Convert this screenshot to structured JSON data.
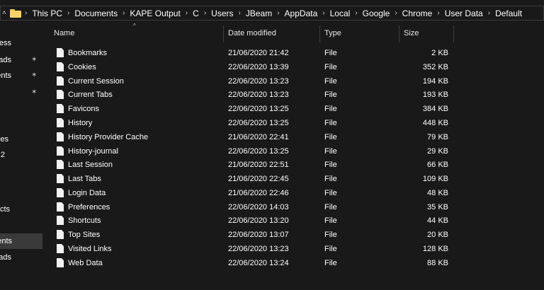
{
  "address_bar": {
    "nav_glyph": "˄",
    "folder_icon": "folder-icon",
    "separator": "›",
    "breadcrumbs": [
      "This PC",
      "Documents",
      "KAPE Output",
      "C",
      "Users",
      "JBeam",
      "AppData",
      "Local",
      "Google",
      "Chrome",
      "User Data",
      "Default"
    ]
  },
  "nav_pane": {
    "items": [
      {
        "label": "ess",
        "pinned": false,
        "selected": false
      },
      {
        "label": "ads",
        "pinned": true,
        "selected": false
      },
      {
        "label": "ents",
        "pinned": true,
        "selected": false
      },
      {
        "label": "",
        "pinned": true,
        "selected": false
      },
      {
        "label": "es",
        "pinned": false,
        "selected": false
      },
      {
        "label": "2",
        "pinned": false,
        "selected": false
      },
      {
        "label": "cts",
        "pinned": false,
        "selected": false
      },
      {
        "label": "ents",
        "pinned": false,
        "selected": true
      },
      {
        "label": "ads",
        "pinned": false,
        "selected": false
      }
    ],
    "pin_glyph": "📌"
  },
  "columns": {
    "name": "Name",
    "date_modified": "Date modified",
    "type": "Type",
    "size": "Size",
    "sort_glyph": "^"
  },
  "files": [
    {
      "name": "Bookmarks",
      "date": "21/06/2020 21:42",
      "type": "File",
      "size": "2 KB"
    },
    {
      "name": "Cookies",
      "date": "22/06/2020 13:39",
      "type": "File",
      "size": "352 KB"
    },
    {
      "name": "Current Session",
      "date": "22/06/2020 13:23",
      "type": "File",
      "size": "194 KB"
    },
    {
      "name": "Current Tabs",
      "date": "22/06/2020 13:23",
      "type": "File",
      "size": "193 KB"
    },
    {
      "name": "Favicons",
      "date": "22/06/2020 13:25",
      "type": "File",
      "size": "384 KB"
    },
    {
      "name": "History",
      "date": "22/06/2020 13:25",
      "type": "File",
      "size": "448 KB"
    },
    {
      "name": "History Provider Cache",
      "date": "21/06/2020 22:41",
      "type": "File",
      "size": "79 KB"
    },
    {
      "name": "History-journal",
      "date": "22/06/2020 13:25",
      "type": "File",
      "size": "29 KB"
    },
    {
      "name": "Last Session",
      "date": "21/06/2020 22:51",
      "type": "File",
      "size": "66 KB"
    },
    {
      "name": "Last Tabs",
      "date": "21/06/2020 22:45",
      "type": "File",
      "size": "109 KB"
    },
    {
      "name": "Login Data",
      "date": "21/06/2020 22:46",
      "type": "File",
      "size": "48 KB"
    },
    {
      "name": "Preferences",
      "date": "22/06/2020 14:03",
      "type": "File",
      "size": "35 KB"
    },
    {
      "name": "Shortcuts",
      "date": "22/06/2020 13:20",
      "type": "File",
      "size": "44 KB"
    },
    {
      "name": "Top Sites",
      "date": "22/06/2020 13:07",
      "type": "File",
      "size": "20 KB"
    },
    {
      "name": "Visited Links",
      "date": "22/06/2020 13:23",
      "type": "File",
      "size": "128 KB"
    },
    {
      "name": "Web Data",
      "date": "22/06/2020 13:24",
      "type": "File",
      "size": "88 KB"
    }
  ],
  "colors": {
    "background": "#191919",
    "text": "#ffffff",
    "selected_nav": "#3a3a3a",
    "folder": "#f5d36c"
  }
}
